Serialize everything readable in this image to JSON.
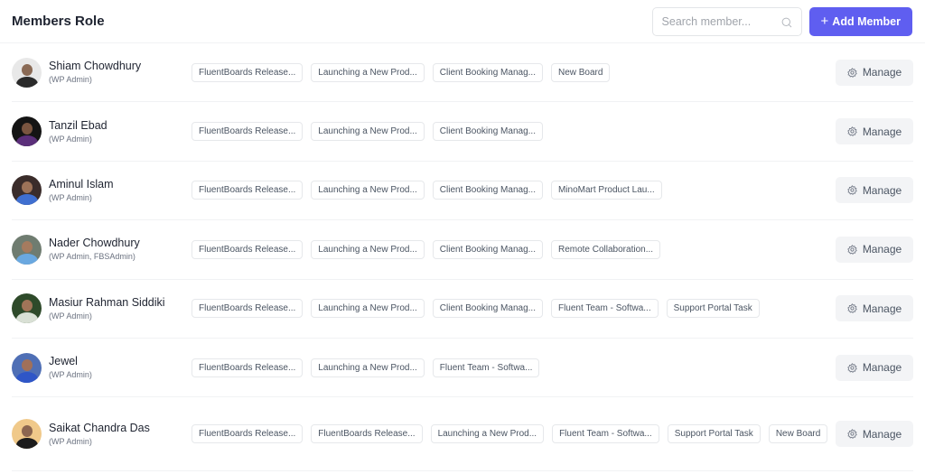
{
  "header": {
    "title": "Members Role",
    "search_placeholder": "Search member...",
    "add_button_label": "Add Member",
    "accent_color": "#5f5ef0"
  },
  "manage_label": "Manage",
  "members": [
    {
      "name": "Shiam Chowdhury",
      "role": "(WP Admin)",
      "avatar": {
        "bg": "#e8e8e8",
        "skin": "#8a6a55",
        "clothes": "#2a2a2a"
      },
      "boards": [
        "FluentBoards Release...",
        "Launching a New Prod...",
        "Client Booking Manag...",
        "New Board"
      ]
    },
    {
      "name": "Tanzil Ebad",
      "role": "(WP Admin)",
      "avatar": {
        "bg": "#141414",
        "skin": "#7a5540",
        "clothes": "#5b2f7a"
      },
      "boards": [
        "FluentBoards Release...",
        "Launching a New Prod...",
        "Client Booking Manag..."
      ]
    },
    {
      "name": "Aminul Islam",
      "role": "(WP Admin)",
      "avatar": {
        "bg": "#3a2c2a",
        "skin": "#9c7258",
        "clothes": "#3f6fd0"
      },
      "boards": [
        "FluentBoards Release...",
        "Launching a New Prod...",
        "Client Booking Manag...",
        "MinoMart Product Lau..."
      ]
    },
    {
      "name": "Nader Chowdhury",
      "role": "(WP Admin, FBSAdmin)",
      "avatar": {
        "bg": "#6f7c70",
        "skin": "#a57b5f",
        "clothes": "#6aa8e0"
      },
      "boards": [
        "FluentBoards Release...",
        "Launching a New Prod...",
        "Client Booking Manag...",
        "Remote Collaboration..."
      ]
    },
    {
      "name": "Masiur Rahman Siddiki",
      "role": "(WP Admin)",
      "avatar": {
        "bg": "#2e4a2a",
        "skin": "#a07458",
        "clothes": "#d9e0d5"
      },
      "boards": [
        "FluentBoards Release...",
        "Launching a New Prod...",
        "Client Booking Manag...",
        "Fluent Team - Softwa...",
        "Support Portal Task"
      ]
    },
    {
      "name": "Jewel",
      "role": "(WP Admin)",
      "avatar": {
        "bg": "#4f6fb5",
        "skin": "#a0705a",
        "clothes": "#2f56c7"
      },
      "boards": [
        "FluentBoards Release...",
        "Launching a New Prod...",
        "Fluent Team - Softwa..."
      ]
    },
    {
      "name": "Saikat Chandra Das",
      "role": "(WP Admin)",
      "avatar": {
        "bg": "#f0c98a",
        "skin": "#8c6650",
        "clothes": "#1c1c1c"
      },
      "boards": [
        "FluentBoards Release...",
        "FluentBoards Release...",
        "Launching a New Prod...",
        "Fluent Team - Softwa...",
        "Support Portal Task",
        "New Board"
      ]
    }
  ]
}
